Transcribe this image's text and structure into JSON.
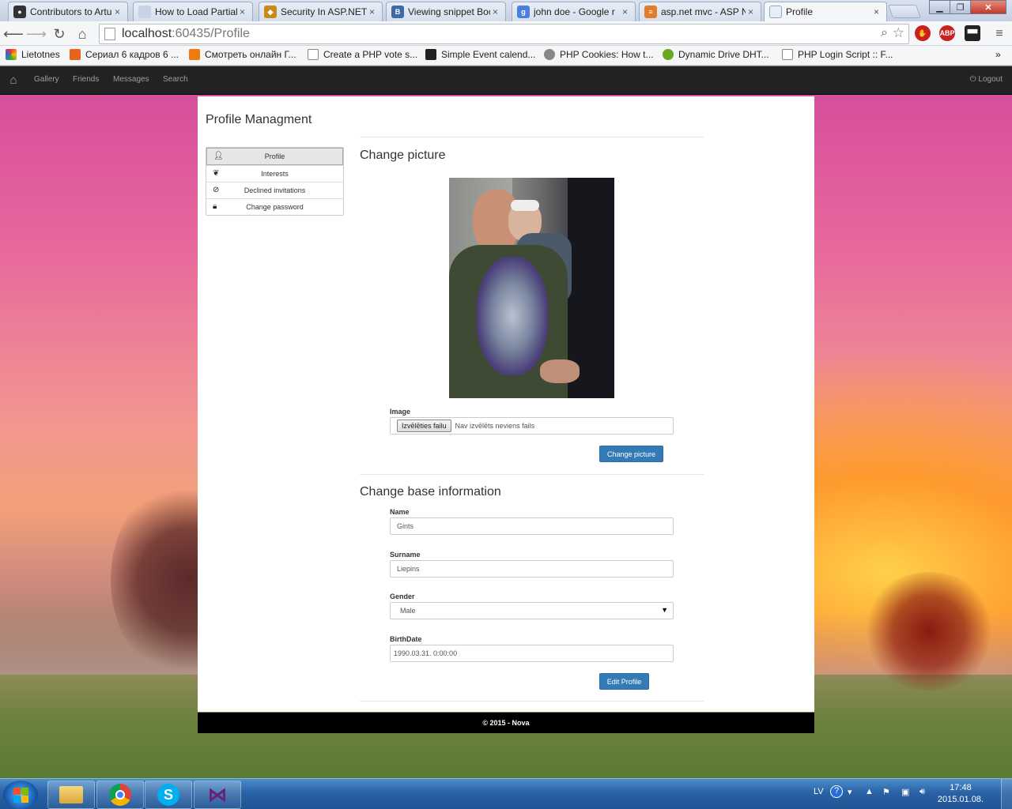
{
  "browser": {
    "tabs": [
      {
        "title": "Contributors to Artu",
        "icon": "github-icon",
        "color": "#333333"
      },
      {
        "title": "How to Load Partial",
        "icon": "page-icon",
        "color": "#6d7a91"
      },
      {
        "title": "Security In ASP.NET",
        "icon": "shield-icon",
        "color": "#c98a16"
      },
      {
        "title": "Viewing snippet Boo",
        "icon": "bootsnipp-icon",
        "color": "#3d6aa8"
      },
      {
        "title": "john doe - Google r",
        "icon": "google-icon",
        "color": "#4a7fe0"
      },
      {
        "title": "asp.net mvc - ASP N",
        "icon": "stackoverflow-icon",
        "color": "#e07c2a"
      },
      {
        "title": "Profile",
        "icon": "document-icon",
        "color": "#8fa6c8"
      }
    ],
    "tab_close": "×",
    "url_host": "localhost",
    "url_path": ":60435/Profile",
    "extensions": [
      "ABP"
    ],
    "bookmarks": [
      {
        "label": "Lietotnes",
        "icon": "apps-icon",
        "color": "#e44"
      },
      {
        "label": "Сериал 6 кадров 6 ...",
        "icon": "fox-icon",
        "color": "#e8621e"
      },
      {
        "label": "Смотреть онлайн Г...",
        "icon": "f-icon",
        "color": "#f07a10"
      },
      {
        "label": "Create a PHP vote s...",
        "icon": "page-icon",
        "color": "#ffffff"
      },
      {
        "label": "Simple Event calend...",
        "icon": "hash-icon",
        "color": "#222222"
      },
      {
        "label": "PHP Cookies: How t...",
        "icon": "globe-icon",
        "color": "#888888"
      },
      {
        "label": "Dynamic Drive DHT...",
        "icon": "d-icon",
        "color": "#6aa820"
      },
      {
        "label": "PHP Login Script :: F...",
        "icon": "page-icon",
        "color": "#ffffff"
      }
    ],
    "bookmarks_more": "»"
  },
  "navbar": {
    "links": [
      "Gallery",
      "Friends",
      "Messages",
      "Search"
    ],
    "logout": "Logout"
  },
  "page": {
    "title": "Profile Managment",
    "menu": [
      {
        "label": "Profile",
        "icon": "user-icon"
      },
      {
        "label": "Interests",
        "icon": "leaf-icon"
      },
      {
        "label": "Declined invitations",
        "icon": "ban-icon"
      },
      {
        "label": "Change password",
        "icon": "lock-icon"
      }
    ],
    "picture_section": {
      "heading": "Change picture",
      "image_label": "Image",
      "file_button": "Izvēlēties failu",
      "file_status": "Nav izvēlēts neviens fails",
      "submit": "Change picture"
    },
    "info_section": {
      "heading": "Change base information",
      "fields": {
        "name_label": "Name",
        "name_value": "Gints",
        "surname_label": "Surname",
        "surname_value": "Liepins",
        "gender_label": "Gender",
        "gender_value": "Male",
        "birth_label": "BirthDate",
        "birth_value": "1990.03.31. 0:00:00"
      },
      "submit": "Edit Profile"
    },
    "footer": "© 2015 - Nova"
  },
  "taskbar": {
    "language": "LV",
    "time": "17:48",
    "date": "2015.01.08."
  }
}
